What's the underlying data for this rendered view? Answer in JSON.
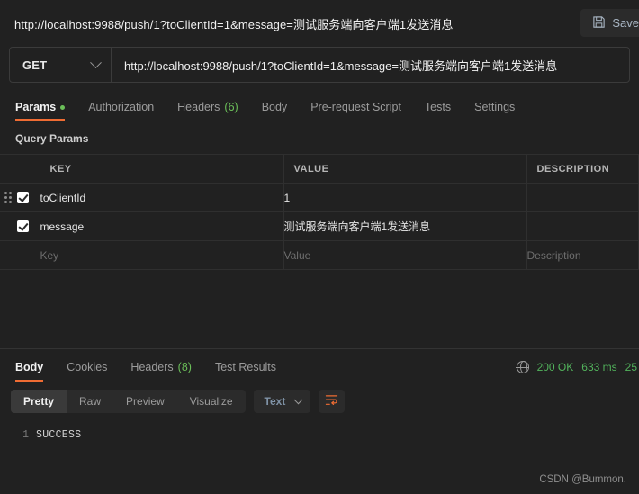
{
  "titlebar": {
    "url": "http://localhost:9988/push/1?toClientId=1&message=测试服务端向客户端1发送消息",
    "save_label": "Save"
  },
  "request": {
    "method": "GET",
    "url": "http://localhost:9988/push/1?toClientId=1&message=测试服务端向客户端1发送消息",
    "tabs": [
      {
        "label": "Params",
        "badge": "",
        "dot": true,
        "active": true
      },
      {
        "label": "Authorization",
        "badge": "",
        "dot": false,
        "active": false
      },
      {
        "label": "Headers",
        "badge": "(6)",
        "dot": false,
        "active": false
      },
      {
        "label": "Body",
        "badge": "",
        "dot": false,
        "active": false
      },
      {
        "label": "Pre-request Script",
        "badge": "",
        "dot": false,
        "active": false
      },
      {
        "label": "Tests",
        "badge": "",
        "dot": false,
        "active": false
      },
      {
        "label": "Settings",
        "badge": "",
        "dot": false,
        "active": false
      }
    ]
  },
  "query_params": {
    "section_title": "Query Params",
    "columns": {
      "key": "KEY",
      "value": "VALUE",
      "description": "DESCRIPTION"
    },
    "rows": [
      {
        "checked": true,
        "key": "toClientId",
        "value": "1",
        "description": ""
      },
      {
        "checked": true,
        "key": "message",
        "value": "测试服务端向客户端1发送消息",
        "description": ""
      }
    ],
    "empty_row": {
      "key": "Key",
      "value": "Value",
      "description": "Description"
    }
  },
  "response": {
    "tabs": [
      {
        "label": "Body",
        "badge": "",
        "active": true
      },
      {
        "label": "Cookies",
        "badge": "",
        "active": false
      },
      {
        "label": "Headers",
        "badge": "(8)",
        "active": false
      },
      {
        "label": "Test Results",
        "badge": "",
        "active": false
      }
    ],
    "status_code": "200 OK",
    "time": "633 ms",
    "size": "25",
    "view_modes": [
      {
        "label": "Pretty",
        "active": true
      },
      {
        "label": "Raw",
        "active": false
      },
      {
        "label": "Preview",
        "active": false
      },
      {
        "label": "Visualize",
        "active": false
      }
    ],
    "format": "Text",
    "body_lines": [
      {
        "num": "1",
        "text": "SUCCESS"
      }
    ]
  },
  "watermark": "CSDN @Bummon.",
  "colors": {
    "accent": "#ef6c33",
    "success": "#6bbf59",
    "status": "#52b35c",
    "background": "#212121",
    "panel": "#2b2b2b"
  }
}
